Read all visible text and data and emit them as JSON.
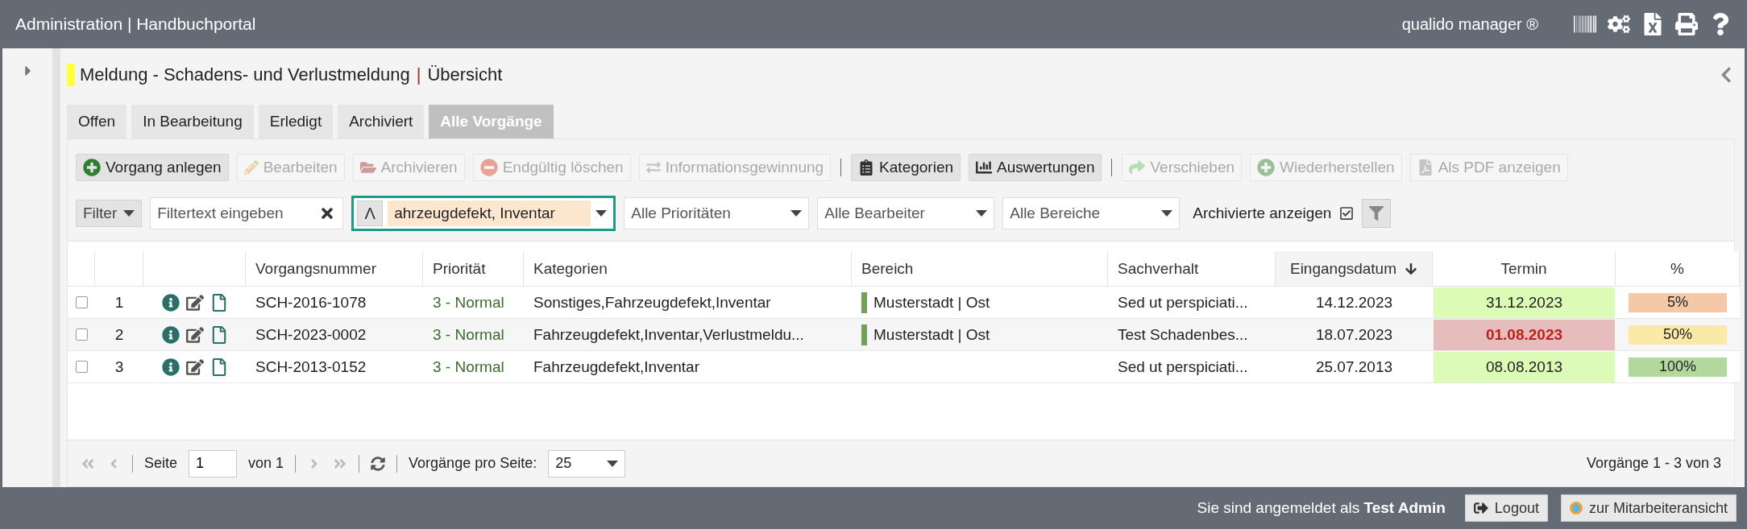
{
  "header": {
    "title": "Administration | Handbuchportal",
    "product": "qualido manager ®"
  },
  "page": {
    "title": "Meldung - Schadens- und Verlustmeldung",
    "separator": "|",
    "subtitle": "Übersicht"
  },
  "tabs": [
    {
      "label": "Offen",
      "selected": false
    },
    {
      "label": "In Bearbeitung",
      "selected": false
    },
    {
      "label": "Erledigt",
      "selected": false
    },
    {
      "label": "Archiviert",
      "selected": false
    },
    {
      "label": "Alle Vorgänge",
      "selected": true
    }
  ],
  "toolbar": [
    [
      {
        "kind": "create",
        "label": "Vorgang anlegen",
        "disabled": false
      },
      {
        "kind": "edit",
        "label": "Bearbeiten",
        "disabled": true
      },
      {
        "kind": "archive",
        "label": "Archivieren",
        "disabled": true
      },
      {
        "kind": "delete",
        "label": "Endgültig löschen",
        "disabled": true
      },
      {
        "kind": "info",
        "label": "Informationsgewinnung",
        "disabled": true
      }
    ],
    [
      {
        "kind": "categories",
        "label": "Kategorien",
        "disabled": false
      },
      {
        "kind": "reports",
        "label": "Auswertungen",
        "disabled": false
      }
    ],
    [
      {
        "kind": "move",
        "label": "Verschieben",
        "disabled": true
      },
      {
        "kind": "restore",
        "label": "Wiederherstellen",
        "disabled": true
      },
      {
        "kind": "pdf",
        "label": "Als PDF anzeigen",
        "disabled": true
      }
    ]
  ],
  "filters": {
    "filter_button": "Filter",
    "search": {
      "placeholder": "Filtertext eingeben"
    },
    "category_toggle": "Λ",
    "category_value": "ahrzeugdefekt, Inventar",
    "selects": [
      "Alle Prioritäten",
      "Alle Bearbeiter",
      "Alle Bereiche"
    ],
    "archived": {
      "label": "Archivierte anzeigen",
      "checked": true
    }
  },
  "table": {
    "columns": [
      "Vorgangsnummer",
      "Priorität",
      "Kategorien",
      "Bereich",
      "Sachverhalt",
      "Eingangsdatum",
      "Termin",
      "%"
    ],
    "rows": [
      {
        "checked": false,
        "index": "1",
        "number": "SCH-2016-1078",
        "priority": "3 - Normal",
        "categories": "Sonstiges,Fahrzeugdefekt,Inventar",
        "area": {
          "text": "Musterstadt | Ost",
          "color": "#76a05a"
        },
        "subject": "Sed ut perspiciati...",
        "received": "14.12.2023",
        "deadline": {
          "text": "31.12.2023",
          "color": "#dcfbb6",
          "overdue": false
        },
        "percent": {
          "text": "5%",
          "color": "#f5c8a8"
        }
      },
      {
        "checked": false,
        "index": "2",
        "number": "SCH-2023-0002",
        "priority": "3 - Normal",
        "categories": "Fahrzeugdefekt,Inventar,Verlustmeldu...",
        "area": {
          "text": "Musterstadt | Ost",
          "color": "#76a05a"
        },
        "subject": "Test Schadenbes...",
        "received": "18.07.2023",
        "deadline": {
          "text": "01.08.2023",
          "color": "#e6bcbc",
          "overdue": true
        },
        "percent": {
          "text": "50%",
          "color": "#fbe9a8"
        }
      },
      {
        "checked": false,
        "index": "3",
        "number": "SCH-2013-0152",
        "priority": "3 - Normal",
        "categories": "Fahrzeugdefekt,Inventar",
        "subject": "Sed ut perspiciati...",
        "received": "25.07.2013",
        "deadline": {
          "text": "08.08.2013",
          "color": "#dcfbb6",
          "overdue": false
        },
        "percent": {
          "text": "100%",
          "color": "#b2d89e"
        }
      }
    ]
  },
  "pager": {
    "page_label": "Seite",
    "page": "1",
    "of": "von 1",
    "per_page_label": "Vorgänge pro Seite:",
    "per_page": "25",
    "summary": "Vorgänge 1 - 3 von 3"
  },
  "footer": {
    "login_text": "Sie sind angemeldet als **Test Admin**",
    "logout": "Logout",
    "employee_view": "zur Mitarbeiteransicht"
  }
}
